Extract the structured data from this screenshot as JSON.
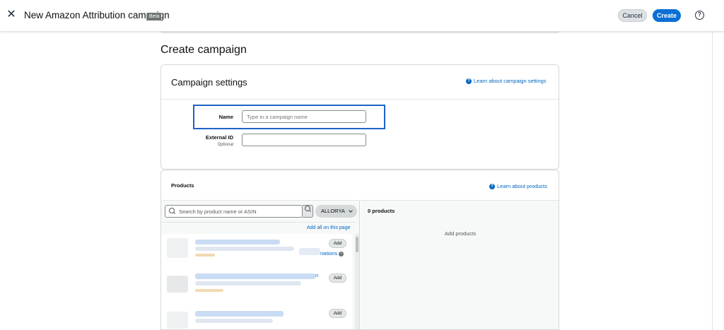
{
  "header": {
    "title": "New Amazon Attribution campaign",
    "badge": "Beta",
    "close_icon": "close-icon",
    "cancel_label": "Cancel",
    "create_label": "Create",
    "help_glyph": "?"
  },
  "page": {
    "title": "Create campaign"
  },
  "settings": {
    "title": "Campaign settings",
    "learn_link": "Learn about campaign settings",
    "name_label": "Name",
    "name_placeholder": "Type in a campaign name",
    "external_label": "External ID",
    "external_sub": "Optional"
  },
  "products": {
    "title": "Products",
    "learn_link": "Learn about products",
    "search_placeholder": "Search by product name or ASIN",
    "brand_selected": "ALLORYA",
    "add_all": "Add all on this page",
    "add_label": "Add",
    "variations_label": "riations",
    "variations_prefix_2": "n",
    "selected_count": "0 products",
    "empty_text": "Add products"
  },
  "colors": {
    "accent": "#0a6fd6",
    "link": "#0066c0",
    "highlight": "#1f63c7"
  }
}
